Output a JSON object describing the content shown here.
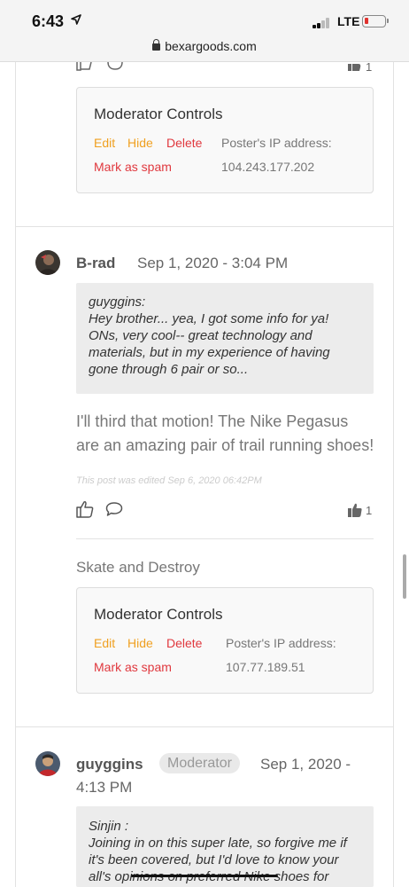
{
  "status_bar": {
    "time": "6:43",
    "network": "LTE"
  },
  "browser": {
    "url": "bexargoods.com"
  },
  "posts": [
    {
      "like_count": "1",
      "moderator": {
        "title": "Moderator Controls",
        "edit": "Edit",
        "hide": "Hide",
        "delete": "Delete",
        "ip_label": "Poster's IP address:",
        "spam": "Mark as spam",
        "ip": "104.243.177.202"
      }
    },
    {
      "author": "B-rad",
      "date": "Sep 1, 2020 - 3:04 PM",
      "quote_lines": [
        "guyggins:",
        "Hey brother... yea, I got some info for ya!",
        "ONs, very cool-- great technology and",
        "materials, but in my experience of having",
        "gone through 6 pair or so..."
      ],
      "body_lines": [
        "I'll third that motion! The Nike Pegasus",
        "are an amazing pair of trail running shoes!"
      ],
      "edited_note": "This post was edited Sep 6, 2020 06:42PM",
      "like_count": "1",
      "signature": "Skate and Destroy",
      "moderator": {
        "title": "Moderator Controls",
        "edit": "Edit",
        "hide": "Hide",
        "delete": "Delete",
        "ip_label": "Poster's IP address:",
        "spam": "Mark as spam",
        "ip": "107.77.189.51"
      }
    },
    {
      "author": "guyggins",
      "role_badge": "Moderator",
      "date_line1": "Sep 1, 2020 -",
      "date_line2": "4:13 PM",
      "quote_lines": [
        "Sinjin :",
        "Joining in on this super late, so forgive me if",
        "it's been covered, but I'd love to know your",
        "all's opinions on preferred Nike shoes for"
      ]
    }
  ],
  "colors": {
    "edit_hide": "#f0a020",
    "delete_spam": "#e0383e",
    "battery_low": "#e0322f"
  }
}
